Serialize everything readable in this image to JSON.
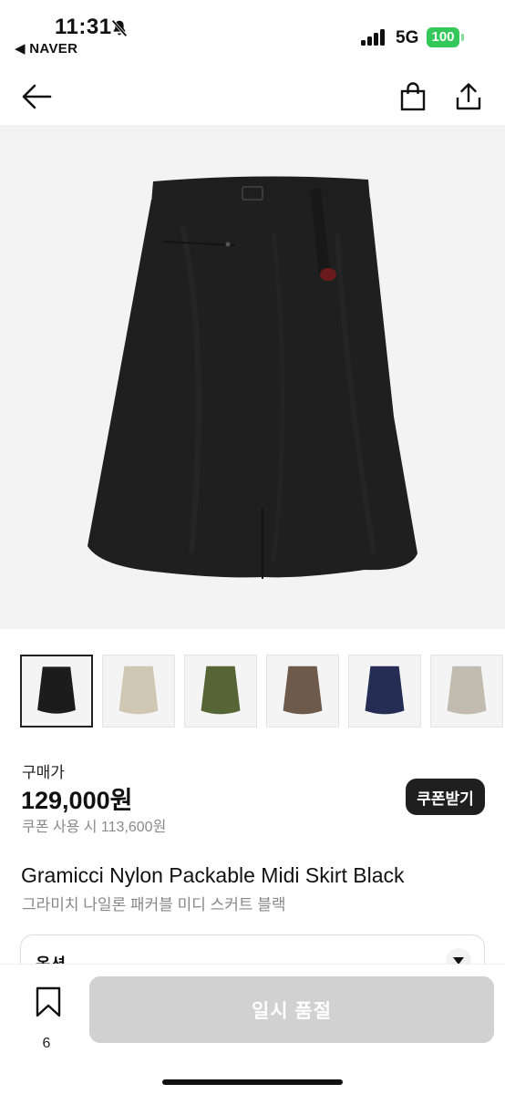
{
  "status_bar": {
    "time": "11:31",
    "back_app": "◀ NAVER",
    "network": "5G",
    "battery": "100"
  },
  "nav": {
    "back_icon": "arrow-left-icon",
    "bag_icon": "shopping-bag-icon",
    "share_icon": "share-icon"
  },
  "colors": {
    "skirt_black": "#1c1c1c",
    "skirt_beige": "#cfc6b4",
    "skirt_olive": "#566536",
    "skirt_brown": "#6e5a4b",
    "skirt_navy": "#252d55",
    "skirt_greige": "#c1bbb0",
    "coupon_button": "#1f1f1f",
    "soldout_button": "#d1d1d1",
    "battery": "#34c759"
  },
  "product": {
    "price_label": "구매가",
    "price": "129,000원",
    "coupon_price": "쿠폰 사용 시 113,600원",
    "coupon_button": "쿠폰받기",
    "title": "Gramicci Nylon Packable Midi Skirt Black",
    "subtitle": "그라미치 나일론 패커블 미디 스커트 블랙"
  },
  "option": {
    "label": "옵션"
  },
  "bottom": {
    "bookmark_count": "6",
    "soldout_label": "일시 품절"
  }
}
